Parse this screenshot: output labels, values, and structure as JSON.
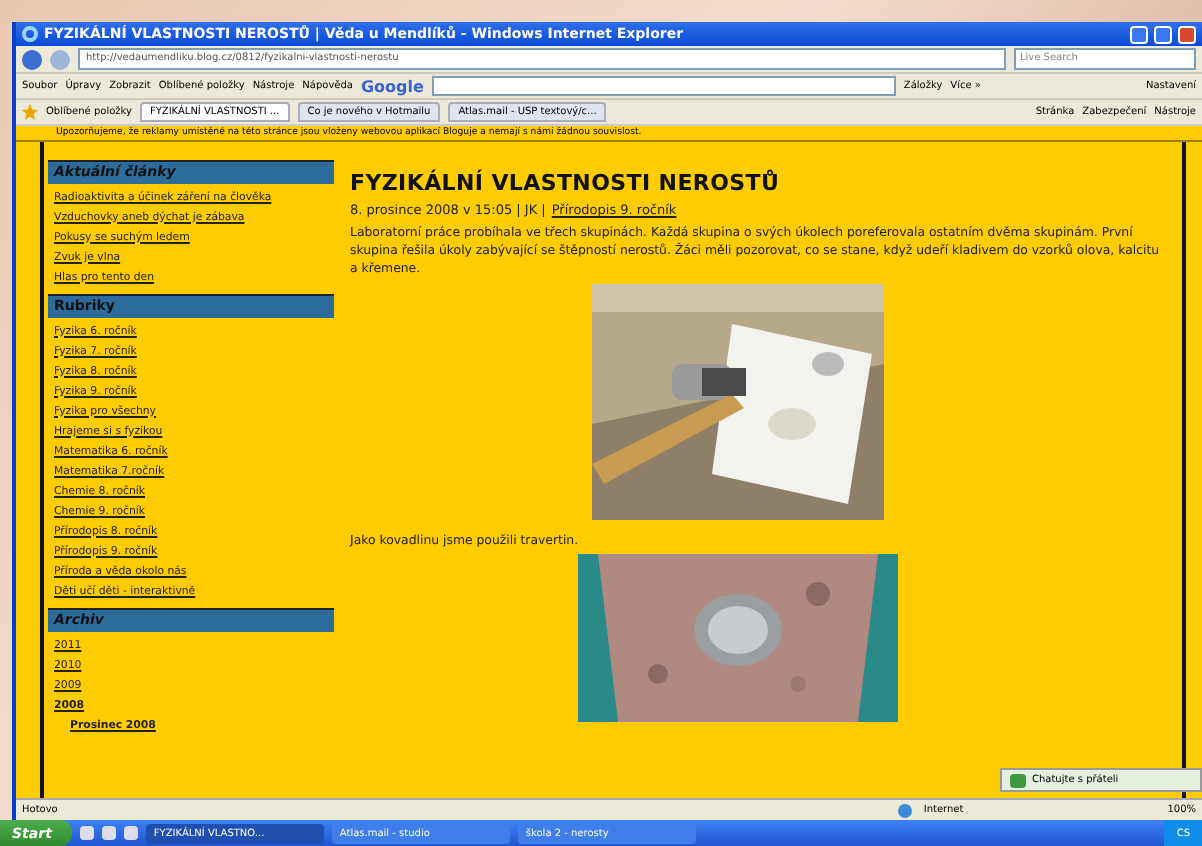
{
  "window": {
    "title": "FYZIKÁLNÍ VLASTNOSTI NEROSTŮ | Věda u Mendlíků - Windows Internet Explorer"
  },
  "address": {
    "value": "http://vedaumendliku.blog.cz/0812/fyzikalni-vlastnosti-nerostu",
    "search_placeholder": "Live Search"
  },
  "menu": [
    "Soubor",
    "Úpravy",
    "Zobrazit",
    "Oblíbené položky",
    "Nástroje",
    "Nápověda"
  ],
  "google": {
    "label": "Google",
    "bookmarks": "Záložky",
    "more": "Více »",
    "settings": "Nastavení"
  },
  "favorites": {
    "label": "Oblíbené položky"
  },
  "tabs": [
    {
      "label": "FYZIKÁLNÍ VLASTNOSTI ...",
      "selected": true
    },
    {
      "label": "Co je nového v Hotmailu",
      "selected": false
    },
    {
      "label": "Atlas.mail - USP textový/c...",
      "selected": false
    }
  ],
  "commands": [
    "Stránka",
    "Zabezpečení",
    "Nástroje"
  ],
  "notice": "Upozorňujeme, že reklamy umístěné na této stránce jsou vloženy webovou aplikací Bloguje a nemají s námi žádnou souvislost.",
  "sidebar": [
    {
      "heading": "Aktuální články",
      "italic": true,
      "items": [
        {
          "label": "Radioaktivita a účinek záření na člověka",
          "bold": false
        },
        {
          "label": "Vzduchovky aneb dýchat je zábava",
          "bold": false
        },
        {
          "label": "Pokusy se suchým ledem",
          "bold": false
        },
        {
          "label": "Zvuk je vlna",
          "bold": false
        },
        {
          "label": "Hlas pro tento den",
          "bold": false
        }
      ]
    },
    {
      "heading": "Rubriky",
      "italic": false,
      "items": [
        {
          "label": "Fyzika 6. ročník",
          "bold": false
        },
        {
          "label": "Fyzika 7. ročník",
          "bold": false
        },
        {
          "label": "Fyzika 8. ročník",
          "bold": false
        },
        {
          "label": "Fyzika 9. ročník",
          "bold": false
        },
        {
          "label": "Fyzika pro všechny",
          "bold": false
        },
        {
          "label": "Hrajeme si s fyzikou",
          "bold": false
        },
        {
          "label": "Matematika 6. ročník",
          "bold": false
        },
        {
          "label": "Matematika 7.ročník",
          "bold": false
        },
        {
          "label": "Chemie 8. ročník",
          "bold": false
        },
        {
          "label": "Chemie 9. ročník",
          "bold": false
        },
        {
          "label": "Přírodopis 8. ročník",
          "bold": false
        },
        {
          "label": "Přírodopis 9. ročník",
          "bold": false
        },
        {
          "label": "Příroda a věda okolo nás",
          "bold": false
        },
        {
          "label": "Děti učí děti - interaktivně",
          "bold": false
        }
      ]
    },
    {
      "heading": "Archiv",
      "italic": true,
      "items": [
        {
          "label": "2011",
          "bold": false
        },
        {
          "label": "2010",
          "bold": false
        },
        {
          "label": "2009",
          "bold": false
        },
        {
          "label": "2008",
          "bold": true,
          "children": [
            {
              "label": "Prosinec 2008",
              "bold": true
            }
          ]
        }
      ]
    }
  ],
  "article": {
    "title": "FYZIKÁLNÍ VLASTNOSTI NEROSTŮ",
    "meta": "8. prosince 2008 v 15:05 | JK |",
    "category": "Přírodopis 9. ročník",
    "body": "Laboratorní práce probíhala ve třech skupinách. Každá skupina o svých úkolech poreferovala ostatním dvěma skupinám. První skupina řešila úkoly zabývající se štěpností nerostů. Žáci měli pozorovat, co se stane, když udeří kladivem do vzorků olova, kalcitu a křemene.",
    "caption": "Jako kovadlinu jsme použili travertin."
  },
  "chat": {
    "label": "Chatujte s přáteli"
  },
  "status": {
    "text": "Hotovo",
    "zone": "Internet",
    "zoom": "100%"
  },
  "taskbar": {
    "start": "Start",
    "tasks": [
      {
        "label": "FYZIKÁLNÍ VLASTNO...",
        "selected": true
      },
      {
        "label": "Atlas.mail - studio",
        "selected": false
      },
      {
        "label": "škola 2 - nerosty",
        "selected": false
      }
    ],
    "lang": "CS"
  }
}
